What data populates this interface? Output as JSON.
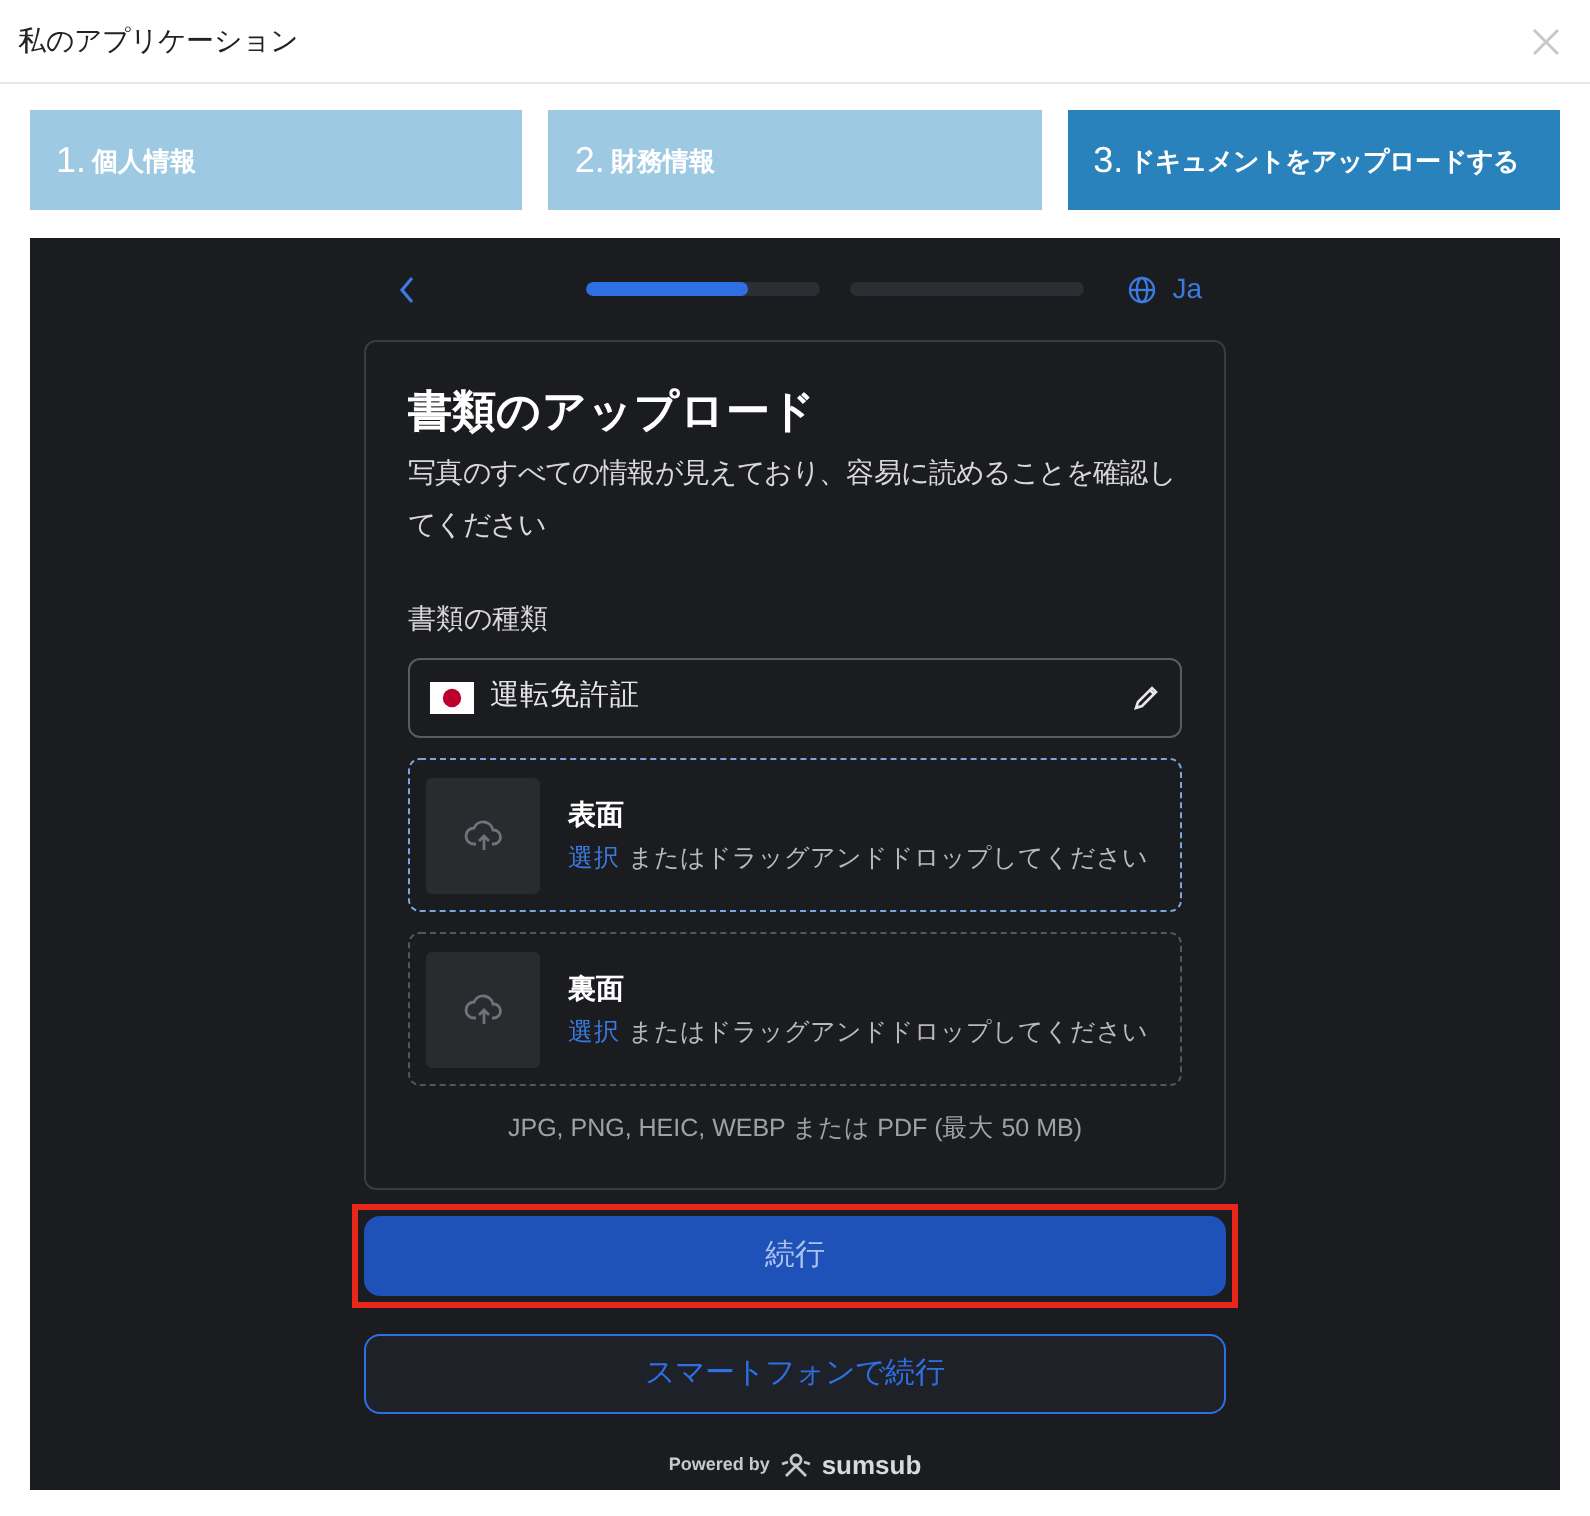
{
  "window": {
    "title": "私のアプリケーション"
  },
  "steps": [
    {
      "number": "1.",
      "label": "個人情報",
      "selected": false
    },
    {
      "number": "2.",
      "label": "財務情報",
      "selected": false
    },
    {
      "number": "3.",
      "label": "ドキュメントをアップロードする",
      "selected": true
    }
  ],
  "nav": {
    "progress": [
      {
        "level": 0.7
      },
      {
        "level": 0
      }
    ],
    "language": "Ja"
  },
  "card": {
    "title": "書類のアップロード",
    "description": "写真のすべての情報が見えており、容易に読めることを確認してください",
    "document_type_label": "書類の種類",
    "document_type": "運転免許証",
    "uploads": [
      {
        "title": "表面",
        "link": "選択",
        "hint": "またはドラッグアンドドロップしてください",
        "selected": true
      },
      {
        "title": "裏面",
        "link": "選択",
        "hint": "またはドラッグアンドドロップしてください",
        "selected": false
      }
    ],
    "formats": "JPG, PNG, HEIC, WEBP または PDF (最大 50 MB)"
  },
  "buttons": [
    {
      "label": "続行",
      "kind": "primary",
      "highlighted": true
    },
    {
      "label": "スマートフォンで続行",
      "kind": "outline",
      "highlighted": false
    }
  ],
  "footer": {
    "powered_by": "Powered by",
    "brand": "sumsub"
  }
}
